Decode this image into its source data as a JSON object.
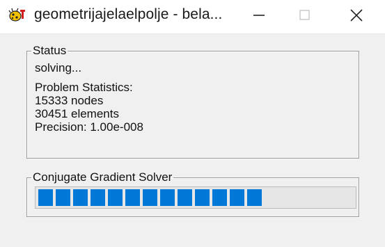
{
  "window": {
    "title": "geometrijajelaelpolje - bela...",
    "app_icon": "app-bug-icon",
    "controls": {
      "minimize": "minimize-icon",
      "maximize": "maximize-icon",
      "close": "close-icon"
    }
  },
  "status_group": {
    "legend": "Status",
    "state": "solving...",
    "stats_heading": "Problem Statistics:",
    "nodes": "15333 nodes",
    "elements": "30451 elements",
    "precision": "Precision: 1.00e-008"
  },
  "solver_group": {
    "legend": "Conjugate Gradient Solver",
    "progress_fraction": 0.74,
    "progress_color": "#0078d7"
  },
  "colors": {
    "client_bg": "#f0f0f0",
    "titlebar_bg": "#ffffff",
    "group_border": "#9a9a9a",
    "progress_track": "#e6e6e6"
  }
}
